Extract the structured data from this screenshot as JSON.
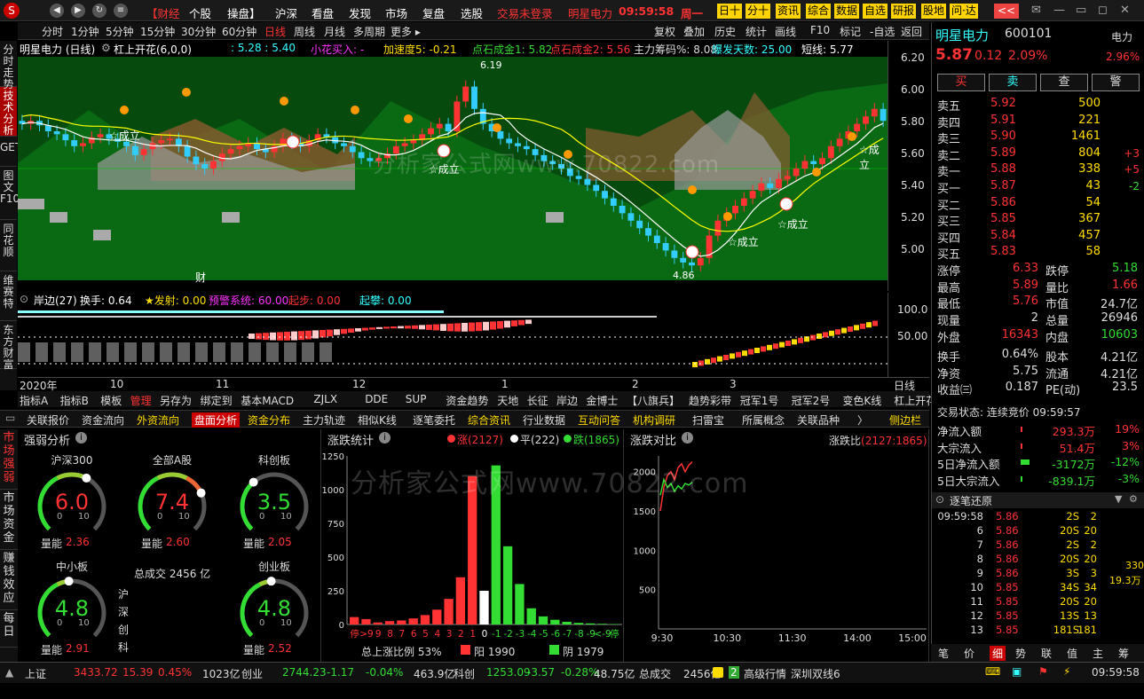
{
  "title_bar": {
    "logo": "S",
    "menus": [
      "【财经",
      "个股",
      "操盘】",
      "沪深",
      "看盘",
      "发现",
      "市场",
      "复盘",
      "选股"
    ],
    "login_status": "交易未登录",
    "stock_name": "明星电力",
    "time": "09:59:58",
    "weekday": "周一",
    "buttons": [
      "日十",
      "分十",
      "资讯",
      "综合",
      "数据",
      "自选",
      "研报",
      "股地",
      "问·达",
      "<<"
    ]
  },
  "period_bar": {
    "periods": [
      "分时",
      "1分钟",
      "5分钟",
      "15分钟",
      "30分钟",
      "60分钟",
      "日线",
      "周线",
      "月线",
      "多周期",
      "更多 ▸"
    ],
    "active": "日线",
    "tools": [
      "复权",
      "叠加",
      "历史",
      "统计",
      "画线",
      "F10",
      "标记",
      "-自选",
      "返回"
    ]
  },
  "vertical_tabs": [
    "分时走势",
    "技术分析",
    "GET",
    "图文F10",
    "同花顺",
    "维赛特",
    "东方财富"
  ],
  "info_line": {
    "name": "明星电力 (日线)",
    "indicator": "杠上开花(6,0,0)",
    "vals": [
      {
        "t": ": 5.28 : 5.40",
        "c": "#3ff"
      },
      {
        "t": "小花买入: -",
        "c": "#f3f"
      },
      {
        "t": "加速度5: -0.21",
        "c": "#fd0"
      },
      {
        "t": "点石成金1: 5.82",
        "c": "#3d3"
      },
      {
        "t": "点石成金2: 5.56",
        "c": "#f33"
      },
      {
        "t": "主力筹码%: 8.08",
        "c": "#ddd"
      },
      {
        "t": "爆发天数: 25.00",
        "c": "#3ff"
      },
      {
        "t": "短线: 5.77",
        "c": "#fff"
      }
    ]
  },
  "price_ticks": [
    "6.20",
    "6.00",
    "5.80",
    "5.60",
    "5.40",
    "5.20",
    "5.00"
  ],
  "chart_labels": {
    "high": "6.19",
    "low": "4.86",
    "chengli": "☆成立",
    "cai": "财"
  },
  "sub_info": {
    "name": "岸边(27)",
    "huanshou": "换手: 0.64",
    "vals": [
      {
        "t": "★发射: 0.00",
        "c": "#fd0"
      },
      {
        "t": "预警系统: 60.00",
        "c": "#f3f"
      },
      {
        "t": "起步: 0.00",
        "c": "#f33"
      },
      {
        "t": "起攀: 0.00",
        "c": "#3ff"
      }
    ]
  },
  "sub_ticks": [
    "100.0",
    "50.00"
  ],
  "date_axis": {
    "labels": [
      "2020年",
      "10",
      "11",
      "12",
      "1",
      "2",
      "3"
    ],
    "period": "日线"
  },
  "indicator_bar": [
    "指标A",
    "指标B",
    "模板",
    "管理",
    "另存为",
    "绑定到",
    "基本MACD",
    "ZJLX",
    "DDE",
    "SUP",
    "资金趋势",
    "天地",
    "长征",
    "岸边",
    "金博士",
    "【八旗兵】",
    "趋势彩带",
    "冠军1号",
    "冠军2号",
    "变色K线",
    "杠上开花",
    "›"
  ],
  "tabbar2": [
    "关联报价",
    "资金流向",
    "外资流向",
    "盘面分析",
    "资金分布",
    "主力轨迹",
    "相似K线",
    "逐笔委托",
    "综合资讯",
    "行业数据",
    "互动问答",
    "机构调研",
    "扫雷宝",
    "所属概念",
    "关联品种",
    "〉",
    "侧边栏"
  ],
  "tabbar2_active": "盘面分析",
  "left_tabs2": [
    "市场强弱",
    "市场资金",
    "赚钱效应",
    "每日"
  ],
  "strength": {
    "title": "强弱分析",
    "gauges": [
      {
        "name": "沪深300",
        "value": "6.0",
        "lnlabel": "量能",
        "ln": "2.36"
      },
      {
        "name": "全部A股",
        "value": "7.4",
        "lnlabel": "量能",
        "ln": "2.60"
      },
      {
        "name": "科创板",
        "value": "3.5",
        "lnlabel": "量能",
        "ln": "2.05"
      },
      {
        "name": "中小板",
        "value": "4.8",
        "lnlabel": "量能",
        "ln": "2.91"
      },
      {
        "name": "创业板",
        "value": "4.8",
        "lnlabel": "量能",
        "ln": "2.52"
      }
    ],
    "gauge_min": "0",
    "gauge_max": "10",
    "total": "总成交 2456 亿",
    "markets": [
      "沪",
      "深",
      "创",
      "科"
    ]
  },
  "chart_data": [
    {
      "type": "bar",
      "title": "涨跌统计",
      "legend": [
        {
          "name": "涨(2127)",
          "color": "#f33"
        },
        {
          "name": "平(222)",
          "color": "#fff"
        },
        {
          "name": "跌(1865)",
          "color": "#3d3"
        }
      ],
      "categories": [
        "停",
        ">9",
        "9",
        "8",
        "7",
        "6",
        "5",
        "4",
        "3",
        "2",
        "1",
        "0",
        "-1",
        "-2",
        "-3",
        "-4",
        "-5",
        "-6",
        "-7",
        "-8",
        "-9",
        "<-9",
        "停"
      ],
      "values": [
        55,
        40,
        15,
        25,
        30,
        45,
        70,
        110,
        190,
        350,
        1100,
        250,
        1180,
        580,
        300,
        120,
        60,
        35,
        20,
        12,
        8,
        5,
        3
      ],
      "colors": [
        "#f33",
        "#f33",
        "#f33",
        "#f33",
        "#f33",
        "#f33",
        "#f33",
        "#f33",
        "#f33",
        "#f33",
        "#f33",
        "#fff",
        "#3d3",
        "#3d3",
        "#3d3",
        "#3d3",
        "#3d3",
        "#3d3",
        "#3d3",
        "#3d3",
        "#3d3",
        "#3d3",
        "#3d3"
      ],
      "yticks": [
        "1250",
        "1000",
        "750",
        "500",
        "250",
        "0"
      ],
      "ylim": [
        0,
        1250
      ],
      "footer": "总上涨比例 53%",
      "yang": "阳 1990",
      "yin": "阴 1979"
    },
    {
      "type": "line",
      "title": "涨跌对比",
      "ratio_label": "涨跌比",
      "ratio": "(2127:1865)",
      "yticks": [
        "2000",
        "1500",
        "1000",
        "500"
      ],
      "xticks": [
        "9:30",
        "10:30",
        "11:30",
        "14:00",
        "15:00"
      ],
      "ylim": [
        0,
        2200
      ],
      "series": [
        {
          "color": "#f33",
          "values": [
            1500,
            1800,
            1950,
            2000,
            1900,
            2050,
            2100,
            2000,
            2080,
            2127
          ]
        },
        {
          "color": "#3d3",
          "values": [
            1700,
            1900,
            1800,
            1850,
            1750,
            1820,
            1780,
            1850,
            1830,
            1865
          ]
        }
      ]
    }
  ],
  "quote": {
    "name": "明星电力",
    "code": "600101",
    "sector": "电力",
    "price": "5.87",
    "change": "0.12",
    "pct": "2.09%",
    "sector_pct": "2.96%",
    "buttons": [
      "买",
      "卖",
      "查",
      "警"
    ],
    "sells": [
      {
        "l": "卖五",
        "p": "5.92",
        "v": "500",
        "d": ""
      },
      {
        "l": "卖四",
        "p": "5.91",
        "v": "221",
        "d": ""
      },
      {
        "l": "卖三",
        "p": "5.90",
        "v": "1461",
        "d": ""
      },
      {
        "l": "卖二",
        "p": "5.89",
        "v": "804",
        "d": "+3"
      },
      {
        "l": "卖一",
        "p": "5.88",
        "v": "338",
        "d": "+5"
      }
    ],
    "buys": [
      {
        "l": "买一",
        "p": "5.87",
        "v": "43",
        "d": "-2"
      },
      {
        "l": "买二",
        "p": "5.86",
        "v": "54",
        "d": ""
      },
      {
        "l": "买三",
        "p": "5.85",
        "v": "367",
        "d": ""
      },
      {
        "l": "买四",
        "p": "5.84",
        "v": "457",
        "d": ""
      },
      {
        "l": "买五",
        "p": "5.83",
        "v": "58",
        "d": ""
      }
    ],
    "stats": [
      [
        "涨停",
        "6.33",
        "跌停",
        "5.18"
      ],
      [
        "最高",
        "5.89",
        "量比",
        "1.66"
      ],
      [
        "最低",
        "5.76",
        "市值",
        "24.7亿"
      ],
      [
        "现量",
        "2",
        "总量",
        "26946"
      ],
      [
        "外盘",
        "16343",
        "内盘",
        "10603"
      ],
      [
        "换手",
        "0.64%",
        "股本",
        "4.21亿"
      ],
      [
        "净资",
        "5.75",
        "流通",
        "4.21亿"
      ],
      [
        "收益㈢",
        "0.187",
        "PE(动)",
        "23.5"
      ]
    ],
    "trade_status": "交易状态: 连续竞价 09:59:57",
    "flows": [
      [
        "净流入额",
        "293.3万",
        "19%"
      ],
      [
        "大宗流入",
        "51.4万",
        "3%"
      ],
      [
        "5日净流入额",
        "-3172万",
        "-12%"
      ],
      [
        "5日大宗流入",
        "-839.1万",
        "-3%"
      ]
    ],
    "tick_title": "逐笔还原",
    "ticks": [
      [
        "09:59:58",
        "5.86",
        "2S",
        "2"
      ],
      [
        "6",
        "5.86",
        "20S",
        "20"
      ],
      [
        "7",
        "5.86",
        "2S",
        "2"
      ],
      [
        "8",
        "5.86",
        "20S",
        "20"
      ],
      [
        "9",
        "5.86",
        "3S",
        "3"
      ],
      [
        "10",
        "5.85",
        "34S",
        "34"
      ],
      [
        "11",
        "5.85",
        "20S",
        "20"
      ],
      [
        "12",
        "5.85",
        "13S",
        "13"
      ],
      [
        "13",
        "5.85",
        "181S",
        "181"
      ]
    ],
    "side_vals": [
      "330",
      "19.3万"
    ],
    "bottom_tabs": [
      "笔",
      "价",
      "细",
      "势",
      "联",
      "值",
      "主",
      "筹"
    ],
    "bottom_active": "细"
  },
  "status_bar": {
    "items": [
      {
        "t": "上证",
        "c": "#ddd"
      },
      {
        "t": "3433.72",
        "c": "#f33"
      },
      {
        "t": "15.39",
        "c": "#f33"
      },
      {
        "t": "0.45%",
        "c": "#f33"
      },
      {
        "t": "1023亿",
        "c": "#ddd"
      },
      {
        "t": "创业",
        "c": "#ddd"
      },
      {
        "t": "2744.23",
        "c": "#3d3"
      },
      {
        "t": "-1.17",
        "c": "#3d3"
      },
      {
        "t": "-0.04%",
        "c": "#3d3"
      },
      {
        "t": "463.9亿",
        "c": "#ddd"
      },
      {
        "t": "科创",
        "c": "#ddd"
      },
      {
        "t": "1253.09",
        "c": "#3d3"
      },
      {
        "t": "-3.57",
        "c": "#3d3"
      },
      {
        "t": "-0.28%",
        "c": "#3d3"
      },
      {
        "t": "48.75亿",
        "c": "#ddd"
      },
      {
        "t": "总成交",
        "c": "#ddd"
      },
      {
        "t": "2456亿",
        "c": "#ddd"
      }
    ],
    "hq": "高级行情",
    "hq_num": "2",
    "line": "深圳双线6",
    "clock": "09:59:58"
  },
  "watermark": "分析家公式网www.70822.com"
}
